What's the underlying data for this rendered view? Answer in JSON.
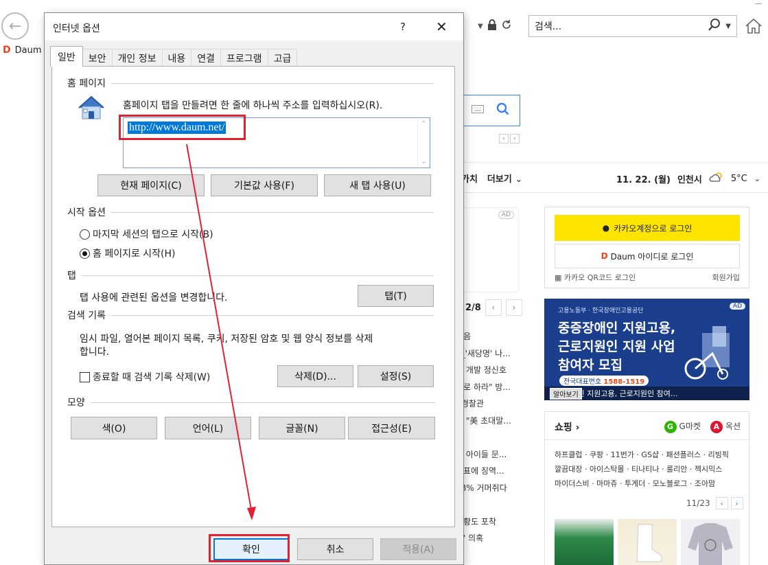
{
  "browser": {
    "search_placeholder": "검색...",
    "tab_title": "Daum"
  },
  "background_page": {
    "gnb_items": [
      "가치",
      "더보기"
    ],
    "date": "11. 22. (월)",
    "location": "인천시",
    "temperature": "5°C",
    "ad_label": "AD",
    "login": {
      "kakao_label": "카카오계정으로 로그인",
      "daum_label": "Daum 아이디로 로그인",
      "qr_label": "카카오 QR코드 로그인",
      "signup_label": "회원가입"
    },
    "pager": "2/8",
    "news": [
      "동음",
      "2_'새당명' 나...",
      "개 개발 정신호",
      "대로 하라\" 방...",
      "| 경찰관",
      "은 \"美 초대말...",
      "다",
      "는 아이들 문...",
      "대표에 징역...",
      "88% 거머쥐다",
      "",
      "빙황도 포착",
      "폐' 의혹"
    ],
    "banner": {
      "org": "고용노동부 · 한국장애인고용공단",
      "line1": "중증장애인 지원고용,",
      "line2": "근로지원인 지원 사업",
      "line3": "참여자 모집",
      "phone_label": "전국대표번호",
      "phone": "1588-1519",
      "foot_text": "중증장애인 지원고용, 근로지원인 참여...",
      "foot_btn": "알아보기"
    },
    "shopping": {
      "title": "쇼핑",
      "gmarket": "G마켓",
      "auction": "옥션",
      "links_row1": "하프클럽 · 쿠팡 · 11번가 · GS샵 · 패션플러스 · 리빙픽",
      "links_row2": "깔끔대장 · 아이스탁몰 · 티나티나 · 룰리안 · 젝시믹스",
      "links_row3": "마이더스비 · 마마쥬 · 투게더 · 모노블로그 · 조아맘",
      "pager": "11/23"
    }
  },
  "dialog": {
    "title": "인터넷 옵션",
    "help": "?",
    "tabs": [
      "일반",
      "보안",
      "개인 정보",
      "내용",
      "연결",
      "프로그램",
      "고급"
    ],
    "home_page": {
      "section": "홈 페이지",
      "instruction": "홈페이지 탭을 만들려면 한 줄에 하나씩 주소를 입력하십시오(R).",
      "url": "http://www.daum.net/",
      "btn_current": "현재 페이지(C)",
      "btn_default": "기본값 사용(F)",
      "btn_newtab": "새 탭 사용(U)"
    },
    "startup": {
      "section": "시작 옵션",
      "opt_last": "마지막 세션의 탭으로 시작(B)",
      "opt_home": "홈 페이지로 시작(H)"
    },
    "tabs_section": {
      "section": "탭",
      "desc": "탭 사용에 관련된 옵션을 변경합니다.",
      "btn": "탭(T)"
    },
    "history": {
      "section": "검색 기록",
      "desc1": "임시 파일, 열어본 페이지 목록, 쿠키, 저장된 암호 및 웹 양식 정보를 삭제",
      "desc2": "합니다.",
      "check": "종료할 때 검색 기록 삭제(W)",
      "btn_delete": "삭제(D)...",
      "btn_settings": "설정(S)"
    },
    "appearance": {
      "section": "모양",
      "btn_color": "색(O)",
      "btn_lang": "언어(L)",
      "btn_font": "글꼴(N)",
      "btn_access": "접근성(E)"
    },
    "footer": {
      "ok": "확인",
      "cancel": "취소",
      "apply": "적용(A)"
    },
    "highlight_color": "#e32030"
  }
}
